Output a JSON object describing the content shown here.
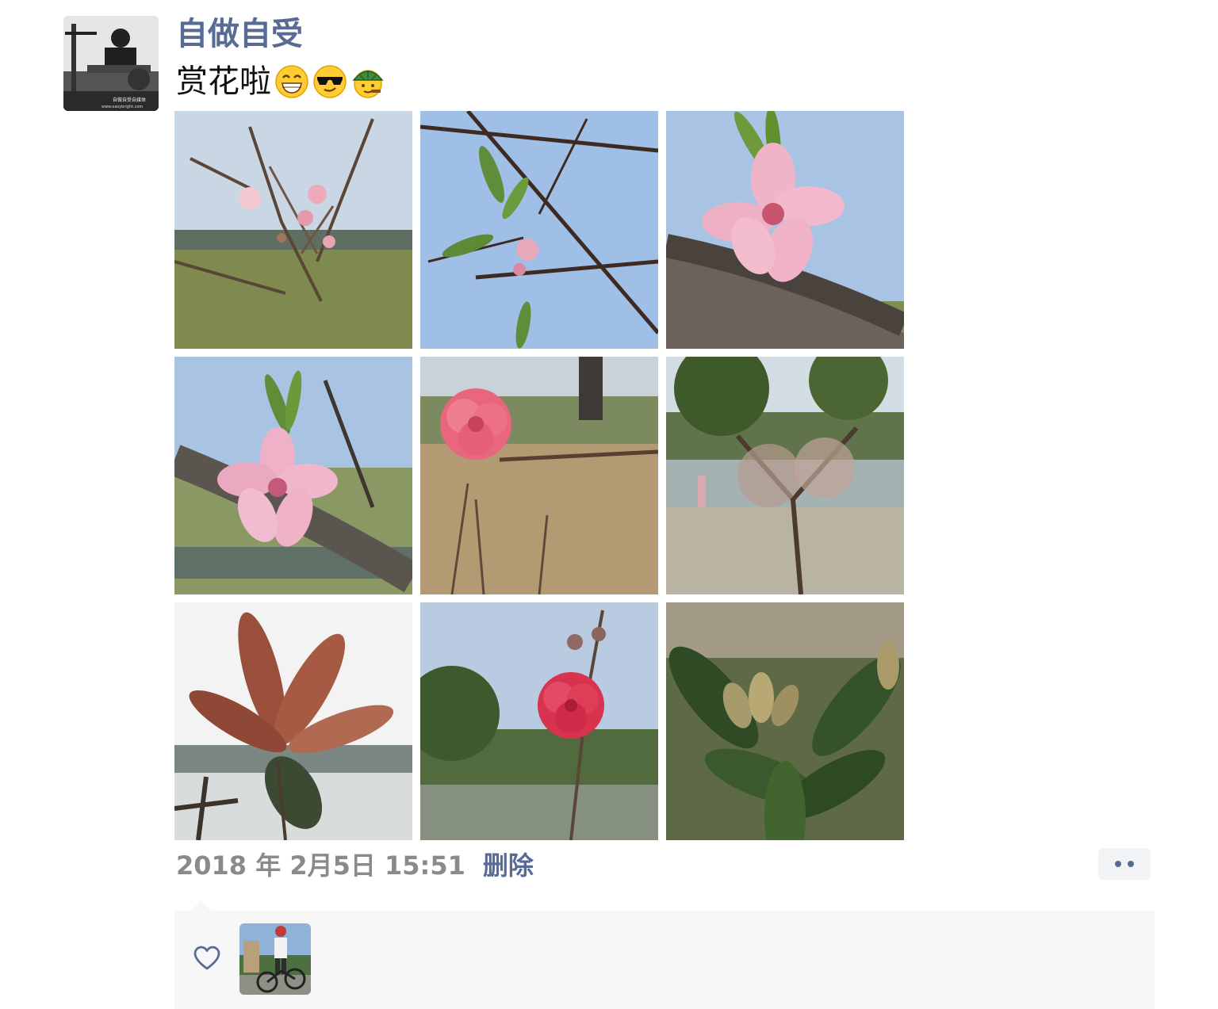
{
  "post": {
    "author": "自做自受",
    "text": "赏花啦",
    "emojis": [
      "grin-emoji",
      "sunglasses-emoji",
      "turtle-emoji"
    ],
    "photos": [
      "peach-blossom-buds-photo",
      "peach-branch-blue-sky-photo",
      "pink-blossom-closeup-photo",
      "pink-blossom-on-branch-photo",
      "red-double-blossom-photo",
      "lakeside-tree-path-photo",
      "red-leaves-over-lake-photo",
      "red-blossom-lake-view-photo",
      "green-leaves-buds-photo"
    ],
    "timestamp": "2018 年 2月5日 15:51",
    "delete_label": "删除",
    "avatar_watermark": "自做自受自媒体",
    "avatar_url_text": "www.easybright.com"
  },
  "likes": {
    "users": [
      "liker-avatar-cyclist"
    ]
  },
  "colors": {
    "name_blue": "#576b95",
    "panel_bg": "#f7f7f7",
    "timestamp_gray": "#8a8a8a"
  }
}
